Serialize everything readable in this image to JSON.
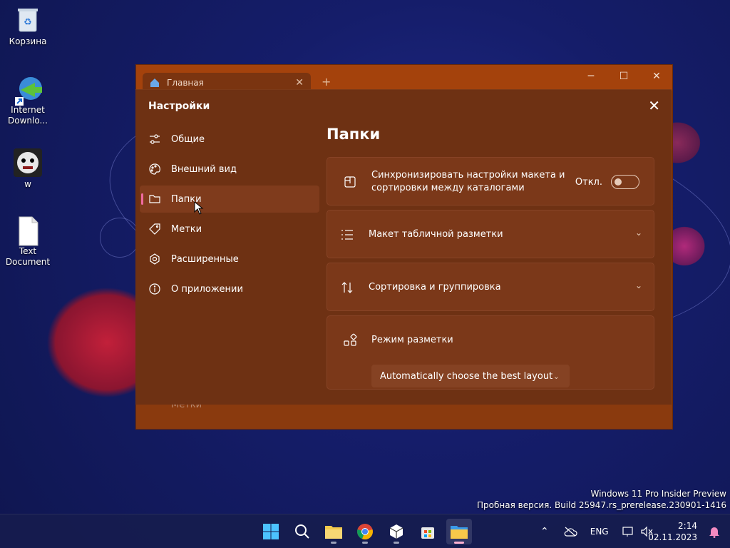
{
  "desktop": {
    "icons": [
      {
        "label": "Корзина"
      },
      {
        "label": "Internet Downlo..."
      },
      {
        "label": "w"
      },
      {
        "label": "Text Document"
      }
    ]
  },
  "window": {
    "tab_title": "Главная",
    "new_tab_symbol": "+",
    "minimize_symbol": "─",
    "maximize_symbol": "☐",
    "close_symbol": "✕"
  },
  "settings": {
    "title": "Настройки",
    "close_symbol": "✕",
    "nav": [
      {
        "label": "Общие",
        "icon": "sliders-icon"
      },
      {
        "label": "Внешний вид",
        "icon": "palette-icon"
      },
      {
        "label": "Папки",
        "icon": "folder-icon",
        "active": true
      },
      {
        "label": "Метки",
        "icon": "tag-icon"
      },
      {
        "label": "Расширенные",
        "icon": "advanced-icon"
      },
      {
        "label": "О приложении",
        "icon": "info-icon"
      }
    ],
    "page_title": "Папки",
    "cards": {
      "sync": {
        "label_line1": "Синхронизировать настройки макета и",
        "label_line2": "сортировки между каталогами",
        "toggle_state": "Откл."
      },
      "layout": {
        "label": "Макет табличной разметки"
      },
      "sort": {
        "label": "Сортировка и группировка"
      },
      "mode": {
        "label": "Режим разметки",
        "dropdown_value": "Automatically choose the best layout"
      }
    },
    "behind_text": "Метки"
  },
  "watermark": {
    "line1": "Windows 11 Pro Insider Preview",
    "line2": "Пробная версия. Build 25947.rs_prerelease.230901-1416"
  },
  "taskbar": {
    "language": "ENG",
    "time": "2:14",
    "date": "02.11.2023"
  },
  "colors": {
    "accent_pink": "#f06aa0",
    "window_titlebar": "#a4420c",
    "dialog_bg": "#6e3113"
  }
}
